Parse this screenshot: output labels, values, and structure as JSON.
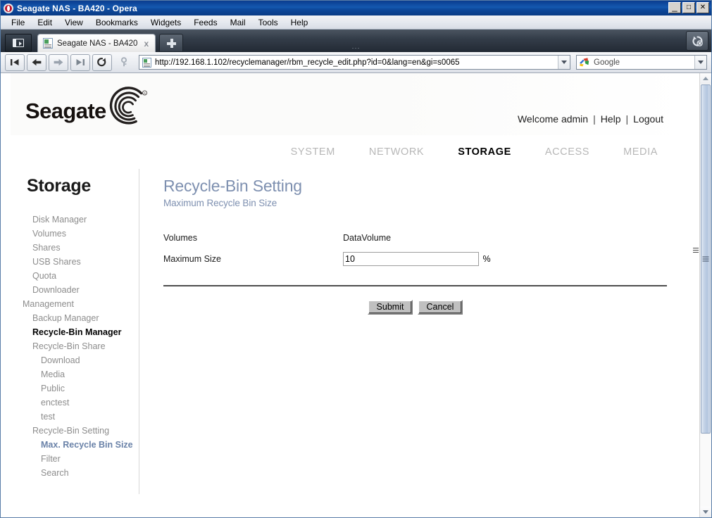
{
  "window": {
    "title": "Seagate NAS - BA420 - Opera",
    "minimize_label": "_",
    "maximize_label": "□",
    "close_label": "✕"
  },
  "menubar": {
    "items": [
      {
        "label": "File"
      },
      {
        "label": "Edit"
      },
      {
        "label": "View"
      },
      {
        "label": "Bookmarks"
      },
      {
        "label": "Widgets"
      },
      {
        "label": "Feeds"
      },
      {
        "label": "Mail"
      },
      {
        "label": "Tools"
      },
      {
        "label": "Help"
      }
    ]
  },
  "tabbar": {
    "panel_toggle_icon": "panel-toggle-icon",
    "active_tab": {
      "title": "Seagate NAS - BA420",
      "favicon": "page-icon",
      "close_label": "x"
    },
    "new_tab_label": "+",
    "trash_icon": "undo-close-tab-icon",
    "drag_dots": "···"
  },
  "toolbar": {
    "buttons": [
      {
        "name": "rewind-button",
        "icon": "rewind-icon"
      },
      {
        "name": "back-button",
        "icon": "arrow-left-icon"
      },
      {
        "name": "forward-button",
        "icon": "arrow-right-icon"
      },
      {
        "name": "fast-forward-button",
        "icon": "fast-forward-icon"
      },
      {
        "name": "reload-button",
        "icon": "reload-icon"
      },
      {
        "name": "security-button",
        "icon": "key-icon"
      }
    ],
    "address": {
      "url": "http://192.168.1.102/recyclemanager/rbm_recycle_edit.php?id=0&lang=en&gi=s0065",
      "icon": "page-icon",
      "dropdown_icon": "chevron-down-icon"
    },
    "search": {
      "engine": "Google",
      "engine_icon": "google-icon",
      "dropdown_icon": "chevron-down-icon"
    }
  },
  "site": {
    "logo_text": "Seagate",
    "logo_mark": "seagate-spiral-mark",
    "header_links": {
      "welcome": "Welcome admin",
      "separator": "|",
      "help": "Help",
      "logout": "Logout"
    },
    "nav_tabs": [
      {
        "label": "SYSTEM",
        "active": false
      },
      {
        "label": "NETWORK",
        "active": false
      },
      {
        "label": "STORAGE",
        "active": true
      },
      {
        "label": "ACCESS",
        "active": false
      },
      {
        "label": "MEDIA",
        "active": false
      }
    ]
  },
  "sidebar": {
    "title": "Storage",
    "items": [
      {
        "label": "Disk Manager",
        "level": 1,
        "state": "normal"
      },
      {
        "label": "Volumes",
        "level": 1,
        "state": "normal"
      },
      {
        "label": "Shares",
        "level": 1,
        "state": "normal"
      },
      {
        "label": "USB Shares",
        "level": 1,
        "state": "normal"
      },
      {
        "label": "Quota",
        "level": 1,
        "state": "normal"
      },
      {
        "label": "Downloader",
        "level": 1,
        "state": "normal"
      },
      {
        "label": "Management",
        "level": 0,
        "state": "normal"
      },
      {
        "label": "Backup Manager",
        "level": 1,
        "state": "normal"
      },
      {
        "label": "Recycle-Bin Manager",
        "level": 1,
        "state": "bold-active"
      },
      {
        "label": "Recycle-Bin Share",
        "level": 1,
        "state": "normal"
      },
      {
        "label": "Download",
        "level": 2,
        "state": "normal"
      },
      {
        "label": "Media",
        "level": 2,
        "state": "normal"
      },
      {
        "label": "Public",
        "level": 2,
        "state": "normal"
      },
      {
        "label": "enctest",
        "level": 2,
        "state": "normal"
      },
      {
        "label": "test",
        "level": 2,
        "state": "normal"
      },
      {
        "label": "Recycle-Bin Setting",
        "level": 1,
        "state": "normal"
      },
      {
        "label": "Max. Recycle Bin Size",
        "level": 2,
        "state": "blue-active"
      },
      {
        "label": "Filter",
        "level": 2,
        "state": "normal"
      },
      {
        "label": "Search",
        "level": 2,
        "state": "normal"
      }
    ]
  },
  "main": {
    "title": "Recycle-Bin Setting",
    "subtitle": "Maximum Recycle Bin Size",
    "form": {
      "rows": [
        {
          "label": "Volumes",
          "value": "DataVolume",
          "type": "text"
        },
        {
          "label": "Maximum Size",
          "value": "10",
          "type": "input",
          "suffix": "%"
        }
      ]
    },
    "buttons": {
      "submit": "Submit",
      "cancel": "Cancel"
    }
  },
  "colors": {
    "title_blue": "#7e90b0",
    "nav_active": "#000000",
    "nav_inactive": "#b7b7b7",
    "sidebar_text": "#8d8d8d",
    "titlebar_blue": "#0e4b9e"
  }
}
